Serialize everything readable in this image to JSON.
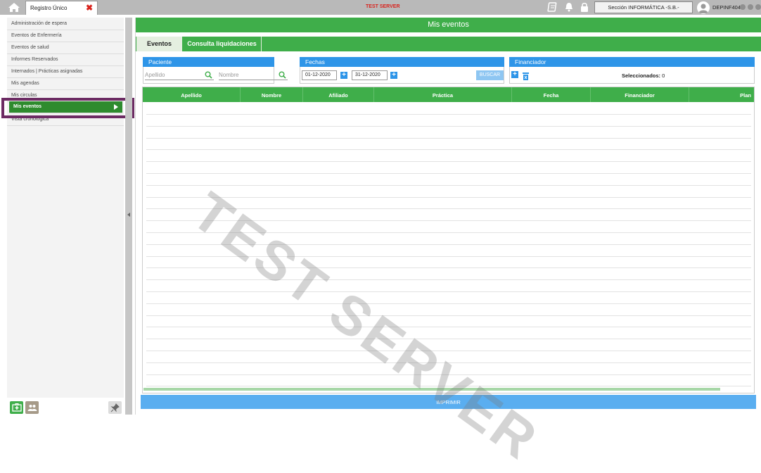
{
  "topbar": {
    "tab_label": "Registro Único",
    "server_label": "TEST SERVER",
    "section_button": "Sección INFORMÁTICA -S.B.-",
    "user": "DEPINF404",
    "icons": [
      "home-icon",
      "close-icon",
      "notebook-icon",
      "bell-icon",
      "lock-icon",
      "user-avatar-icon"
    ]
  },
  "sidebar": {
    "items": [
      {
        "label": "Administración de espera"
      },
      {
        "label": "Eventos de Enfermería"
      },
      {
        "label": "Eventos de salud"
      },
      {
        "label": "Informes Reservados"
      },
      {
        "label": "Internados | Prácticas asignadas"
      },
      {
        "label": "Mis agendas"
      },
      {
        "label": "Mis circulas"
      },
      {
        "label": "Mis eventos",
        "active": true
      },
      {
        "label": "Vista cronológica"
      }
    ],
    "footer_icons": [
      "medical-kit-icon",
      "group-icon",
      "pin-icon"
    ]
  },
  "main": {
    "title": "Mis eventos",
    "tabs": [
      {
        "label": "Eventos",
        "active": true
      },
      {
        "label": "Consulta liquidaciones"
      }
    ],
    "filters": {
      "paciente": {
        "header": "Paciente",
        "apellido_placeholder": "Apellido",
        "nombre_placeholder": "Nombre"
      },
      "fechas": {
        "header": "Fechas",
        "desde": "01-12-2020",
        "hasta": "31-12-2020",
        "buscar_label": "BUSCAR"
      },
      "financiador": {
        "header": "Financiador",
        "selected_label": "Seleccionados:",
        "selected_count": "0"
      }
    },
    "table": {
      "columns": [
        "Apellido",
        "Nombre",
        "Afiliado",
        "Práctica",
        "Fecha",
        "Financiador",
        "Plan"
      ],
      "rows": []
    },
    "watermark": "TEST SERVER",
    "print_label": "IMPRIMIR"
  },
  "colors": {
    "green": "#3fae4a",
    "dark_green": "#2e8b2e",
    "blue": "#2e95e8",
    "highlight": "#6c2b63",
    "red": "#d9221c"
  }
}
